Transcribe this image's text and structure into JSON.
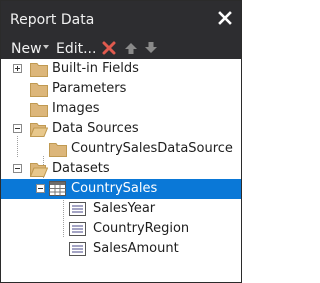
{
  "window": {
    "title": "Report Data"
  },
  "toolbar": {
    "new_label": "New",
    "edit_label": "Edit...",
    "accent_colors": {
      "delete": "#e05a4e",
      "selection": "#0a78d7",
      "chrome": "#2d2d30"
    }
  },
  "tree": {
    "built_in_fields": {
      "label": "Built-in Fields",
      "expander": "plus",
      "icon": "folder-icon"
    },
    "parameters": {
      "label": "Parameters",
      "icon": "folder-icon"
    },
    "images": {
      "label": "Images",
      "icon": "folder-icon"
    },
    "data_sources": {
      "label": "Data Sources",
      "expander": "minus",
      "icon": "folder-icon",
      "children": [
        {
          "label": "CountrySalesDataSource",
          "icon": "folder-icon"
        }
      ]
    },
    "datasets": {
      "label": "Datasets",
      "expander": "minus",
      "icon": "folder-icon",
      "children": [
        {
          "label": "CountrySales",
          "expander": "minus",
          "icon": "table-icon",
          "selected": true,
          "fields": [
            {
              "label": "SalesYear",
              "icon": "field-icon"
            },
            {
              "label": "CountryRegion",
              "icon": "field-icon"
            },
            {
              "label": "SalesAmount",
              "icon": "field-icon"
            }
          ]
        }
      ]
    }
  }
}
